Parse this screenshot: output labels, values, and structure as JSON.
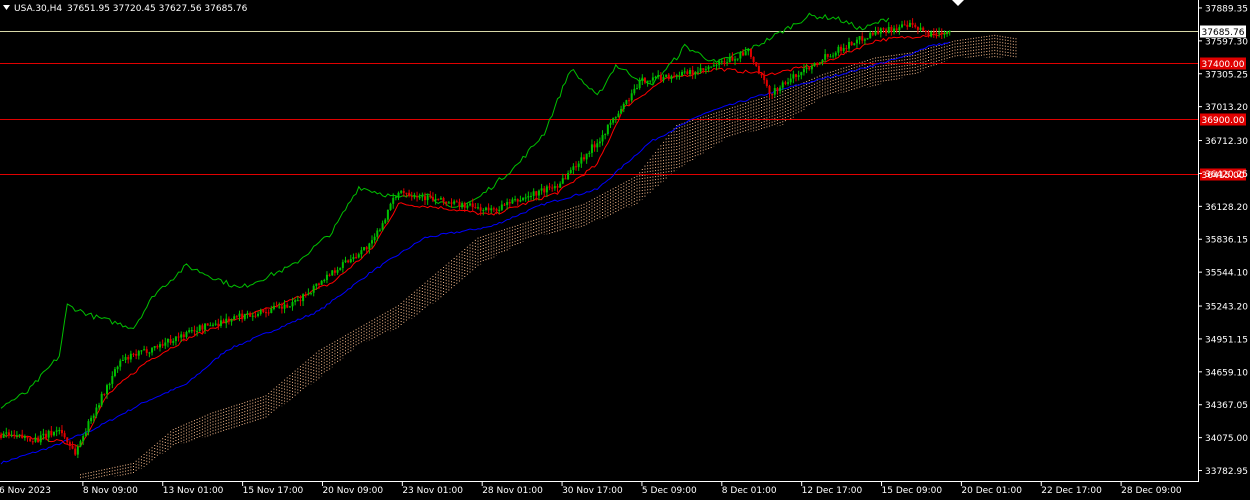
{
  "header": {
    "symbol_label": "USA.30,H4",
    "ohlc_text": "37651.95 37720.45 37627.56 37685.76"
  },
  "colors": {
    "background": "#000000",
    "bull_candle": "#00c000",
    "bear_candle": "#e00000",
    "tenkan_line": "#ff0000",
    "kijun_line": "#0000ff",
    "chikou_line": "#00c000",
    "cloud_hatch": "#f4b88a",
    "axis_text": "#ffffff",
    "current_price_line": "#d8d8a8",
    "level_line": "#e00000",
    "level_label_bg": "#e00000"
  },
  "chart_data": {
    "type": "candlestick",
    "title": "",
    "xlabel": "",
    "ylabel": "",
    "ylim": [
      33690,
      37960
    ],
    "y_ticks": [
      "37889.35",
      "37597.30",
      "37305.25",
      "37013.20",
      "36712.30",
      "36420.25",
      "36128.20",
      "35836.15",
      "35544.10",
      "35243.20",
      "34951.15",
      "34659.10",
      "34367.05",
      "34075.00",
      "33782.95"
    ],
    "x_ticks": [
      "6 Nov 2023",
      "8 Nov 09:00",
      "13 Nov 01:00",
      "15 Nov 17:00",
      "20 Nov 09:00",
      "23 Nov 01:00",
      "28 Nov 01:00",
      "30 Nov 17:00",
      "5 Dec 09:00",
      "8 Dec 01:00",
      "12 Dec 17:00",
      "15 Dec 09:00",
      "20 Dec 01:00",
      "22 Dec 17:00",
      "28 Dec 09:00"
    ],
    "current_price": {
      "value": 37685.76,
      "label": "37685.76"
    },
    "levels": [
      {
        "value": 37400.0,
        "label": "37400.00"
      },
      {
        "value": 36900.0,
        "label": "36900.00"
      },
      {
        "value": 36415.0,
        "label": "36415.00"
      }
    ],
    "price_anchors": [
      [
        0,
        34100
      ],
      [
        14,
        34060
      ],
      [
        22,
        34150
      ],
      [
        28,
        33940
      ],
      [
        35,
        34300
      ],
      [
        45,
        34750
      ],
      [
        60,
        34900
      ],
      [
        75,
        35050
      ],
      [
        90,
        35150
      ],
      [
        110,
        35250
      ],
      [
        125,
        35550
      ],
      [
        140,
        35800
      ],
      [
        150,
        36270
      ],
      [
        165,
        36180
      ],
      [
        185,
        36090
      ],
      [
        210,
        36320
      ],
      [
        225,
        36700
      ],
      [
        242,
        37250
      ],
      [
        265,
        37330
      ],
      [
        282,
        37500
      ],
      [
        290,
        37130
      ],
      [
        310,
        37450
      ],
      [
        330,
        37680
      ],
      [
        343,
        37730
      ],
      [
        350,
        37660
      ],
      [
        358,
        37686
      ]
    ],
    "tenkan_anchors": [
      [
        0,
        34100
      ],
      [
        20,
        34050
      ],
      [
        30,
        34000
      ],
      [
        40,
        34450
      ],
      [
        55,
        34750
      ],
      [
        70,
        34950
      ],
      [
        85,
        35100
      ],
      [
        105,
        35250
      ],
      [
        125,
        35450
      ],
      [
        140,
        35750
      ],
      [
        150,
        36150
      ],
      [
        165,
        36120
      ],
      [
        185,
        36050
      ],
      [
        210,
        36250
      ],
      [
        225,
        36500
      ],
      [
        235,
        37000
      ],
      [
        250,
        37250
      ],
      [
        270,
        37350
      ],
      [
        290,
        37300
      ],
      [
        310,
        37400
      ],
      [
        330,
        37600
      ],
      [
        350,
        37650
      ],
      [
        358,
        37660
      ]
    ],
    "kijun_anchors": [
      [
        0,
        33850
      ],
      [
        20,
        34000
      ],
      [
        35,
        34150
      ],
      [
        55,
        34400
      ],
      [
        70,
        34550
      ],
      [
        85,
        34850
      ],
      [
        100,
        35000
      ],
      [
        120,
        35200
      ],
      [
        140,
        35550
      ],
      [
        160,
        35850
      ],
      [
        185,
        35950
      ],
      [
        205,
        36150
      ],
      [
        225,
        36280
      ],
      [
        245,
        36700
      ],
      [
        265,
        36950
      ],
      [
        285,
        37100
      ],
      [
        300,
        37200
      ],
      [
        320,
        37320
      ],
      [
        340,
        37450
      ],
      [
        350,
        37550
      ],
      [
        358,
        37580
      ]
    ],
    "chikou_anchors": [
      [
        0,
        34350
      ],
      [
        10,
        34480
      ],
      [
        22,
        34800
      ],
      [
        25,
        35250
      ],
      [
        35,
        35150
      ],
      [
        50,
        35050
      ],
      [
        58,
        35350
      ],
      [
        70,
        35600
      ],
      [
        80,
        35500
      ],
      [
        90,
        35400
      ],
      [
        110,
        35600
      ],
      [
        125,
        35900
      ],
      [
        135,
        36300
      ],
      [
        150,
        36200
      ],
      [
        160,
        36250
      ],
      [
        170,
        36100
      ],
      [
        180,
        36200
      ],
      [
        195,
        36500
      ],
      [
        205,
        36780
      ],
      [
        215,
        37350
      ],
      [
        225,
        37100
      ],
      [
        232,
        37380
      ],
      [
        245,
        37200
      ],
      [
        255,
        37450
      ],
      [
        258,
        37550
      ],
      [
        270,
        37400
      ],
      [
        285,
        37550
      ],
      [
        305,
        37820
      ],
      [
        315,
        37800
      ],
      [
        325,
        37700
      ],
      [
        335,
        37800
      ]
    ],
    "cloud_anchors": [
      [
        30,
        33750,
        33700
      ],
      [
        50,
        33850,
        33750
      ],
      [
        65,
        34150,
        34000
      ],
      [
        80,
        34300,
        34100
      ],
      [
        100,
        34450,
        34250
      ],
      [
        120,
        34850,
        34600
      ],
      [
        135,
        35050,
        34900
      ],
      [
        150,
        35250,
        35050
      ],
      [
        165,
        35550,
        35300
      ],
      [
        180,
        35850,
        35600
      ],
      [
        200,
        36000,
        35850
      ],
      [
        220,
        36150,
        35950
      ],
      [
        240,
        36400,
        36150
      ],
      [
        255,
        36850,
        36450
      ],
      [
        275,
        37000,
        36750
      ],
      [
        295,
        37150,
        36850
      ],
      [
        310,
        37300,
        37100
      ],
      [
        330,
        37450,
        37200
      ],
      [
        345,
        37500,
        37300
      ],
      [
        360,
        37600,
        37450
      ],
      [
        375,
        37650,
        37450
      ],
      [
        383,
        37620,
        37450
      ]
    ]
  }
}
